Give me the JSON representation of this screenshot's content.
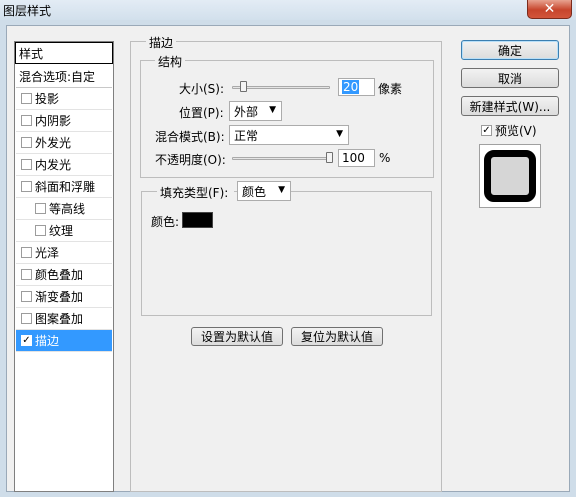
{
  "window": {
    "title": "图层样式",
    "close_glyph": "✕"
  },
  "style_list": {
    "header": "样式",
    "blending_options": "混合选项:自定",
    "items": [
      {
        "label": "投影",
        "checked": false,
        "indent": false,
        "check_glyph": ""
      },
      {
        "label": "内阴影",
        "checked": false,
        "indent": false,
        "check_glyph": ""
      },
      {
        "label": "外发光",
        "checked": false,
        "indent": false,
        "check_glyph": ""
      },
      {
        "label": "内发光",
        "checked": false,
        "indent": false,
        "check_glyph": ""
      },
      {
        "label": "斜面和浮雕",
        "checked": false,
        "indent": false,
        "check_glyph": ""
      },
      {
        "label": "等高线",
        "checked": false,
        "indent": true,
        "check_glyph": ""
      },
      {
        "label": "纹理",
        "checked": false,
        "indent": true,
        "check_glyph": ""
      },
      {
        "label": "光泽",
        "checked": false,
        "indent": false,
        "check_glyph": ""
      },
      {
        "label": "颜色叠加",
        "checked": false,
        "indent": false,
        "check_glyph": ""
      },
      {
        "label": "渐变叠加",
        "checked": false,
        "indent": false,
        "check_glyph": ""
      },
      {
        "label": "图案叠加",
        "checked": false,
        "indent": false,
        "check_glyph": ""
      },
      {
        "label": "描边",
        "checked": true,
        "indent": false,
        "selected": true,
        "check_glyph": "✓"
      }
    ]
  },
  "stroke": {
    "group_title": "描边",
    "structure_title": "结构",
    "size": {
      "label": "大小(S):",
      "value": "20",
      "unit": "像素",
      "level": 0.04
    },
    "position": {
      "label": "位置(P):",
      "value": "外部"
    },
    "blend_mode": {
      "label": "混合模式(B):",
      "value": "正常"
    },
    "opacity": {
      "label": "不透明度(O):",
      "value": "100",
      "unit": "%",
      "level": 1.0
    },
    "fill_type": {
      "label": "填充类型(F):",
      "value": "颜色"
    },
    "color": {
      "label": "颜色:",
      "hex": "#000000"
    },
    "make_default": "设置为默认值",
    "reset_default": "复位为默认值"
  },
  "buttons": {
    "ok": "确定",
    "cancel": "取消",
    "new_style": "新建样式(W)...",
    "preview": {
      "label": "预览(V)",
      "checked": true,
      "check_glyph": "✓"
    }
  },
  "dropdown_arrow": "▼",
  "colors": {
    "selection": "#3399ff",
    "close_button": "#c7452c"
  }
}
